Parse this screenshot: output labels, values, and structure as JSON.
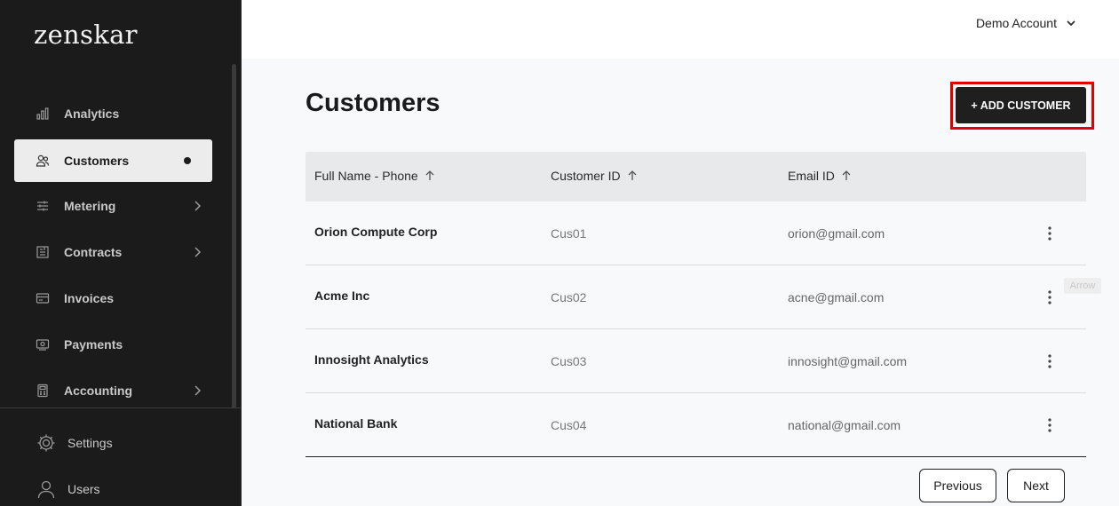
{
  "app": {
    "logo": "zenskar"
  },
  "sidebar": {
    "items": [
      {
        "label": "Analytics",
        "icon": "bar-chart-icon"
      },
      {
        "label": "Customers",
        "icon": "users-icon",
        "active": true
      },
      {
        "label": "Metering",
        "icon": "sliders-icon",
        "has_submenu": true
      },
      {
        "label": "Contracts",
        "icon": "contract-icon",
        "has_submenu": true
      },
      {
        "label": "Invoices",
        "icon": "invoice-icon"
      },
      {
        "label": "Payments",
        "icon": "payment-icon"
      },
      {
        "label": "Accounting",
        "icon": "calculator-icon",
        "has_submenu": true
      }
    ],
    "footer": [
      {
        "label": "Settings",
        "icon": "gear-icon"
      },
      {
        "label": "Users",
        "icon": "user-icon"
      }
    ]
  },
  "header": {
    "account_name": "Demo Account"
  },
  "page": {
    "title": "Customers",
    "add_button": "+ ADD CUSTOMER"
  },
  "table": {
    "columns": [
      "Full Name - Phone",
      "Customer ID",
      "Email ID"
    ],
    "rows": [
      {
        "name": "Orion Compute Corp",
        "id": "Cus01",
        "email": "orion@gmail.com"
      },
      {
        "name": "Acme Inc",
        "id": "Cus02",
        "email": "acne@gmail.com"
      },
      {
        "name": "Innosight Analytics",
        "id": "Cus03",
        "email": "innosight@gmail.com"
      },
      {
        "name": "National Bank",
        "id": "Cus04",
        "email": "national@gmail.com"
      }
    ]
  },
  "tooltip": "Arrow",
  "pagination": {
    "previous": "Previous",
    "next": "Next"
  },
  "colors": {
    "sidebar_bg": "#1b1b1b",
    "button_bg": "#1f1f1f",
    "highlight": "#e00000",
    "header_row_bg": "#e8e9eb"
  }
}
